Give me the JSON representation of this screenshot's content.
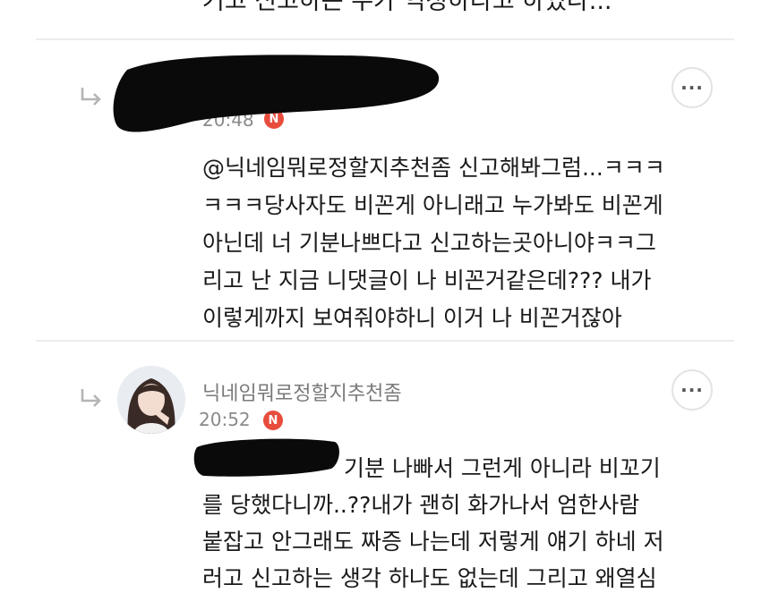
{
  "top_comment": {
    "partial_text": "거고 신고하는 누가 억정하라고 하였다..."
  },
  "reply1": {
    "timestamp": "20:48",
    "new_badge": "N",
    "lines": [
      "@닉네임뭐로정할지추천좀  신고해봐그럼...ㅋㅋㅋ",
      "ㅋㅋㅋ당사자도 비꼰게 아니래고 누가봐도 비꼰게",
      "아닌데 너 기분나쁘다고 신고하는곳아니야ㅋㅋ그",
      "리고 난 지금 니댓글이 나 비꼰거같은데??? 내가",
      "이렇게까지 보여줘야하니 이거 나 비꼰거잖아"
    ]
  },
  "reply2": {
    "username": "닉네임뭐로정할지추천좀",
    "timestamp": "20:52",
    "new_badge": "N",
    "lines": [
      "기분 나빠서 그런게 아니라 비꼬기",
      "를 당했다니까..??내가 괜히 화가나서 엄한사람",
      "붙잡고 안그래도 짜증 나는데 저렇게 얘기 하네 저",
      "러고 신고하는 생각 하나도 없는데 그리고 왜열심"
    ]
  },
  "icons": {
    "reply": "reply-arrow-icon",
    "more": "more-horizontal-icon"
  },
  "more_label": "···",
  "colors": {
    "badge": "#e84c3d",
    "divider": "#ececec",
    "meta_text": "#8a8a8a"
  }
}
